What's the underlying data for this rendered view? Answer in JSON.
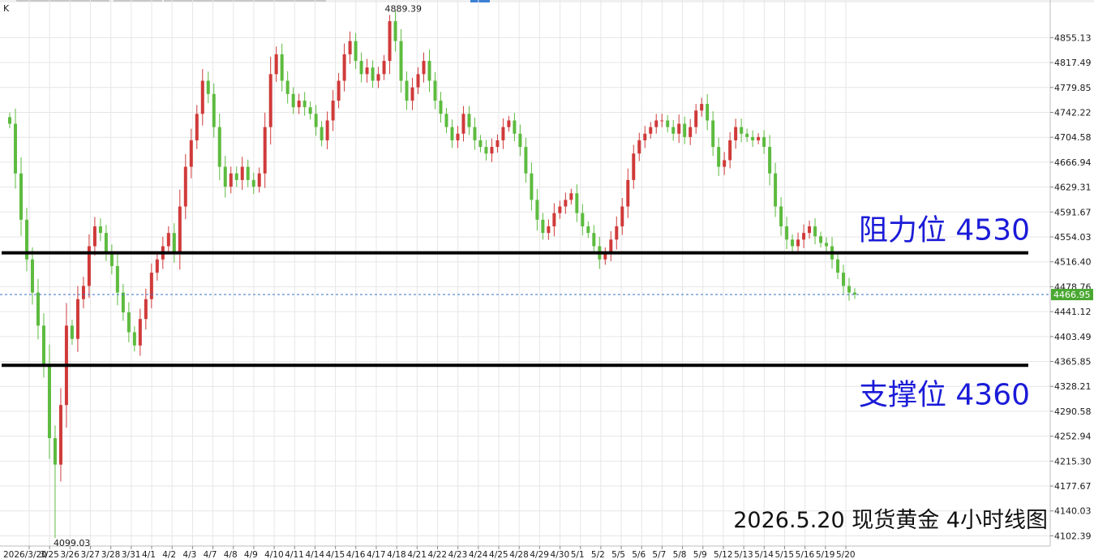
{
  "window": {
    "corner_label": "K"
  },
  "chart_data": {
    "type": "candlestick",
    "title": "2026.5.20 现货黄金 4小时线图",
    "y_ticks": [
      "4855.13",
      "4817.49",
      "4779.85",
      "4742.22",
      "4704.58",
      "4666.94",
      "4629.31",
      "4591.67",
      "4554.03",
      "4516.40",
      "4478.76",
      "4441.12",
      "4403.49",
      "4365.85",
      "4328.21",
      "4290.58",
      "4252.94",
      "4215.30",
      "4177.67",
      "4140.03",
      "4102.39"
    ],
    "ylim": [
      4087,
      4912
    ],
    "x_ticks": [
      "2026/3/20",
      "3/25",
      "3/26",
      "3/27",
      "3/28",
      "3/31",
      "4/1",
      "4/2",
      "4/3",
      "4/7",
      "4/8",
      "4/9",
      "4/10",
      "4/11",
      "4/14",
      "4/15",
      "4/16",
      "4/17",
      "4/18",
      "4/21",
      "4/22",
      "4/23",
      "4/24",
      "4/25",
      "4/28",
      "4/29",
      "4/30",
      "5/1",
      "5/2",
      "5/5",
      "5/6",
      "5/7",
      "5/8",
      "5/9",
      "5/12",
      "5/13",
      "5/14",
      "5/15",
      "5/16",
      "5/19",
      "5/20"
    ],
    "current_price": "4466.95",
    "high_label": "4889.39",
    "low_label": "4099.03",
    "colors": {
      "up": "#d03a3a",
      "down": "#5dbb3f",
      "level_line": "#000000",
      "current_line": "#3a6fc4",
      "current_badge": "#4aa832",
      "annotation": "#1b1bd8"
    },
    "levels": [
      {
        "name": "resistance",
        "label": "阻力位 4530",
        "value": 4530
      },
      {
        "name": "support",
        "label": "支撑位 4360",
        "value": 4360
      }
    ],
    "closes": [
      4725,
      4650,
      4580,
      4520,
      4470,
      4420,
      4360,
      4250,
      4210,
      4300,
      4420,
      4400,
      4460,
      4480,
      4540,
      4570,
      4560,
      4530,
      4510,
      4470,
      4440,
      4410,
      4390,
      4430,
      4460,
      4500,
      4520,
      4540,
      4560,
      4530,
      4600,
      4660,
      4700,
      4740,
      4790,
      4770,
      4720,
      4660,
      4630,
      4650,
      4640,
      4660,
      4640,
      4630,
      4650,
      4720,
      4800,
      4830,
      4790,
      4770,
      4750,
      4760,
      4750,
      4740,
      4720,
      4700,
      4730,
      4760,
      4790,
      4830,
      4850,
      4820,
      4800,
      4810,
      4790,
      4800,
      4820,
      4880,
      4850,
      4790,
      4760,
      4780,
      4800,
      4820,
      4790,
      4760,
      4740,
      4720,
      4700,
      4710,
      4740,
      4720,
      4700,
      4690,
      4680,
      4690,
      4700,
      4720,
      4730,
      4710,
      4690,
      4650,
      4610,
      4580,
      4560,
      4570,
      4590,
      4600,
      4610,
      4620,
      4590,
      4570,
      4560,
      4540,
      4520,
      4530,
      4550,
      4570,
      4600,
      4640,
      4680,
      4700,
      4710,
      4720,
      4730,
      4730,
      4720,
      4710,
      4725,
      4705,
      4720,
      4745,
      4755,
      4730,
      4690,
      4660,
      4670,
      4700,
      4720,
      4710,
      4705,
      4700,
      4705,
      4690,
      4650,
      4600,
      4570,
      4550,
      4540,
      4550,
      4560,
      4570,
      4555,
      4545,
      4540,
      4520,
      4500,
      4480,
      4470,
      4467
    ]
  }
}
